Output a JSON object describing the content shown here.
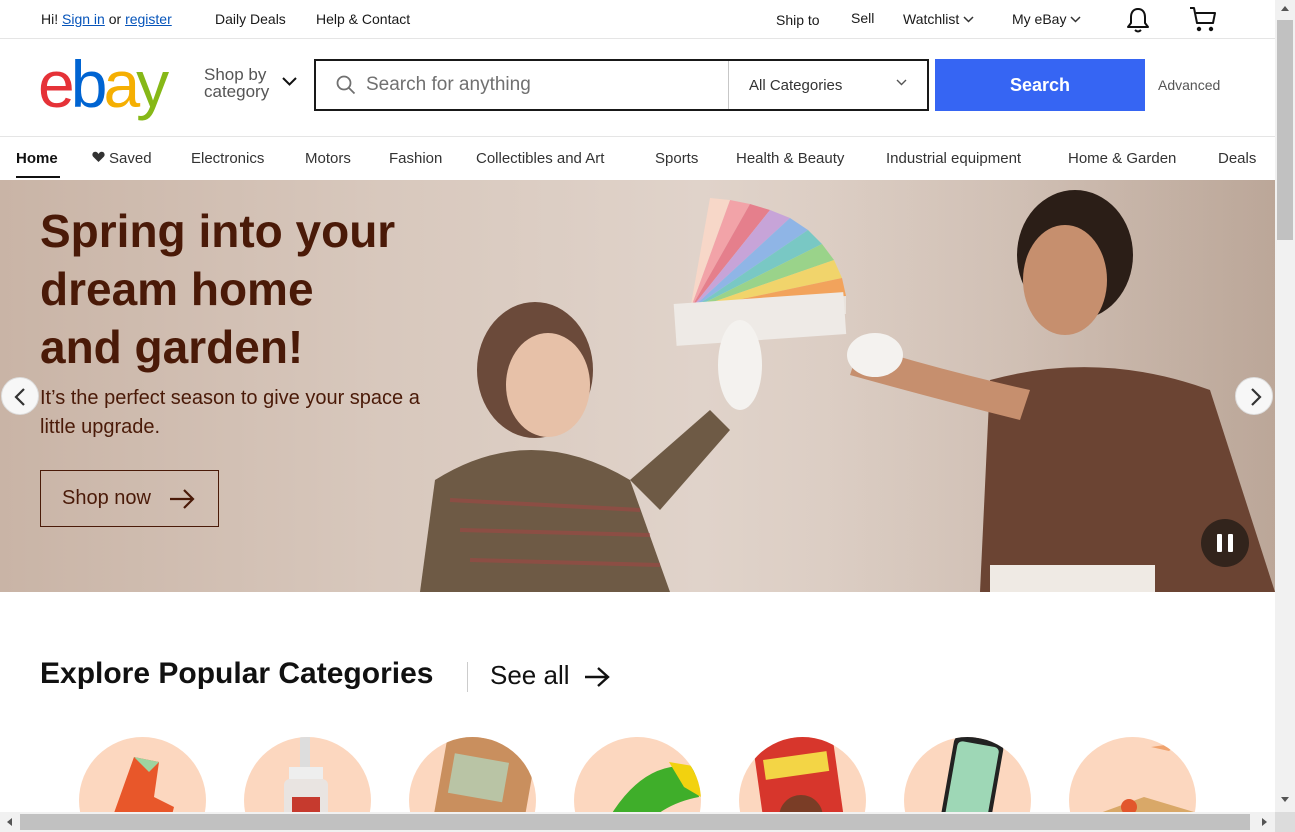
{
  "topbar": {
    "greeting": "Hi!",
    "sign_in": "Sign in",
    "or": "or",
    "register": "register",
    "daily_deals": "Daily Deals",
    "help_contact": "Help & Contact",
    "ship_to": "Ship to",
    "sell": "Sell",
    "watchlist": "Watchlist",
    "my_ebay": "My eBay",
    "icons": [
      "bell-icon",
      "cart-icon"
    ]
  },
  "header": {
    "logo": [
      "e",
      "b",
      "a",
      "y"
    ],
    "logo_colors": [
      "#e53238",
      "#0064d2",
      "#f5af02",
      "#86b817"
    ],
    "shop_by": "Shop by",
    "category": "category",
    "search_placeholder": "Search for anything",
    "category_select": "All Categories",
    "search_button": "Search",
    "advanced": "Advanced",
    "accent_color": "#3665f3"
  },
  "nav": {
    "items": [
      "Home",
      "Saved",
      "Electronics",
      "Motors",
      "Fashion",
      "Collectibles and Art",
      "Sports",
      "Health & Beauty",
      "Industrial equipment",
      "Home & Garden",
      "Deals"
    ],
    "active": "Home"
  },
  "hero": {
    "title_lines": [
      "Spring into your",
      "dream home",
      "and garden!"
    ],
    "subtitle": "It’s the perfect season to give your space a little upgrade.",
    "button": "Shop now",
    "text_color": "#4a1a08"
  },
  "explore": {
    "title": "Explore Popular Categories",
    "see_all": "See all",
    "category_images": [
      "sneaker",
      "serum-bottle",
      "gold-watch",
      "toy",
      "comic-book",
      "smartphone",
      "package"
    ]
  }
}
